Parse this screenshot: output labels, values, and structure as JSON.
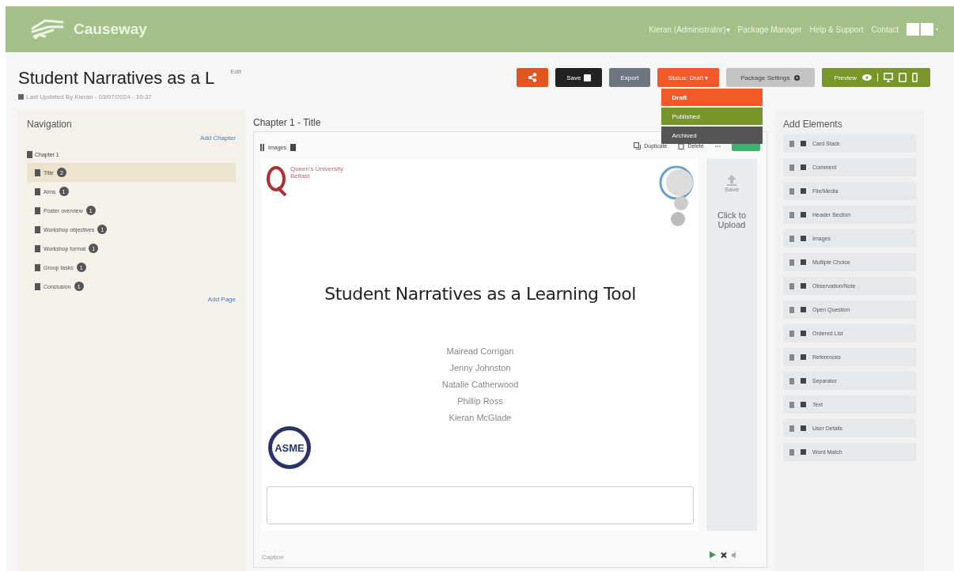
{
  "header": {
    "brand": "Causeway",
    "links": [
      {
        "label": "Kieran (Administrator)",
        "caret": "▾"
      },
      {
        "label": "Package Manager"
      },
      {
        "label": "Help & Support"
      },
      {
        "label": "Contact"
      }
    ]
  },
  "page": {
    "title": "Student Narratives as a L",
    "edit_link": "Edit",
    "last_updated": "Last Updated By Kieran - 03/07/2024 - 10:37"
  },
  "toolbar": {
    "save": "Save",
    "export": "Export",
    "status": "Status: Draft",
    "status_caret": "▾",
    "package_settings": "Package Settings",
    "preview": "Preview"
  },
  "status_menu": [
    {
      "label": "Draft",
      "color": "#f05a28",
      "selected": true
    },
    {
      "label": "Published",
      "color": "#77952b",
      "selected": false
    },
    {
      "label": "Archived",
      "color": "#555555",
      "selected": false
    }
  ],
  "navigation": {
    "title": "Navigation",
    "add_chapter": "Add Chapter",
    "add_page": "Add Page",
    "tree": [
      {
        "label": "Chapter 1",
        "children": [
          {
            "label": "Title",
            "count": "2",
            "selected": true
          },
          {
            "label": "Aims",
            "count": "1",
            "selected": false
          },
          {
            "label": "Poster overview",
            "count": "1",
            "selected": false
          },
          {
            "label": "Workshop objectives",
            "count": "1",
            "selected": false
          },
          {
            "label": "Workshop format",
            "count": "1",
            "selected": false
          },
          {
            "label": "Group tasks",
            "count": "1",
            "selected": false
          },
          {
            "label": "Conclusion",
            "count": "1",
            "selected": false
          }
        ]
      }
    ]
  },
  "editor": {
    "heading": "Chapter 1 - Title",
    "element_type": "Images",
    "duplicate": "Duplicate",
    "delete": "Delete",
    "more": "•••",
    "upload_label": "Click to Upload",
    "upload_small": "Save",
    "footer_note": "Caption",
    "slide": {
      "university": "Queen's University Belfast",
      "title": "Student Narratives as a Learning Tool",
      "authors": [
        "Mairead Corrigan",
        "Jenny Johnston",
        "Natalie Catherwood",
        "Phillip Ross",
        "Kieran McGlade"
      ],
      "badge": "ASME"
    }
  },
  "add_elements": {
    "title": "Add Elements",
    "items": [
      "Card Stack",
      "Comment",
      "File/Media",
      "Header Section",
      "Images",
      "Multiple Choice",
      "Observation/Note",
      "Open Question",
      "Ordered List",
      "References",
      "Separator",
      "Text",
      "User Details",
      "Word Match"
    ]
  }
}
